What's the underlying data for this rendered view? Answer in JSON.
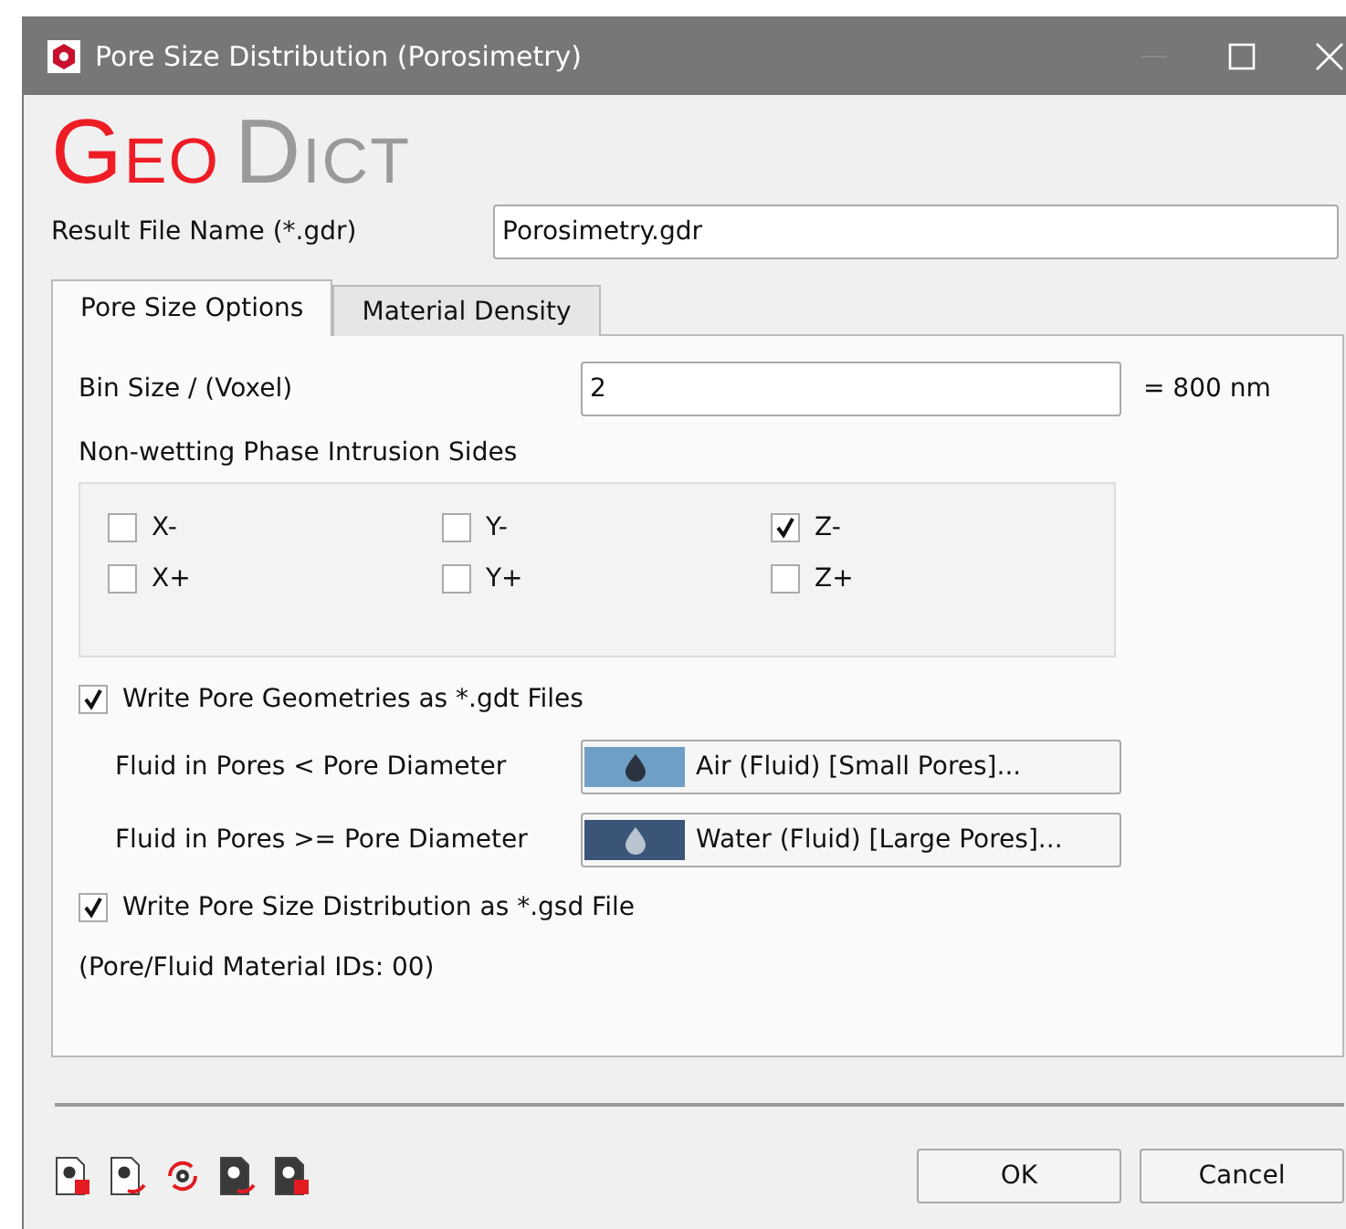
{
  "window": {
    "title": "Pore Size Distribution (Porosimetry)"
  },
  "logo": [
    {
      "text": "Geo",
      "color": "#ee1c25"
    },
    {
      "text": "Dict",
      "color": "#9a9a9a"
    }
  ],
  "result_file": {
    "label": "Result File Name (*.gdr)",
    "value": "Porosimetry.gdr"
  },
  "tabs": [
    {
      "label": "Pore Size Options",
      "selected": true
    },
    {
      "label": "Material Density",
      "selected": false
    }
  ],
  "bin_size": {
    "label": "Bin Size / (Voxel)",
    "value": "2",
    "reading": "= 800 nm"
  },
  "intrusion": {
    "label": "Non-wetting Phase Intrusion Sides",
    "sides": [
      {
        "label": "X-",
        "checked": false
      },
      {
        "label": "Y-",
        "checked": false
      },
      {
        "label": "Z-",
        "checked": true
      },
      {
        "label": "X+",
        "checked": false
      },
      {
        "label": "Y+",
        "checked": false
      },
      {
        "label": "Z+",
        "checked": false
      }
    ]
  },
  "write_geometries": {
    "label": "Write Pore Geometries as *.gdt Files",
    "checked": true
  },
  "fluids": [
    {
      "label": "Fluid in Pores <  Pore Diameter",
      "material": "Air (Fluid) [Small Pores]...",
      "color": "#6f9fc4"
    },
    {
      "label": "Fluid in Pores >= Pore Diameter",
      "material": "Water (Fluid) [Large Pores]...",
      "color": "#3a5578"
    }
  ],
  "write_distribution": {
    "label": "Write Pore Size Distribution as *.gsd File",
    "checked": true
  },
  "material_ids": "(Pore/Fluid Material IDs: 00)",
  "buttons": [
    "OK",
    "Cancel"
  ]
}
